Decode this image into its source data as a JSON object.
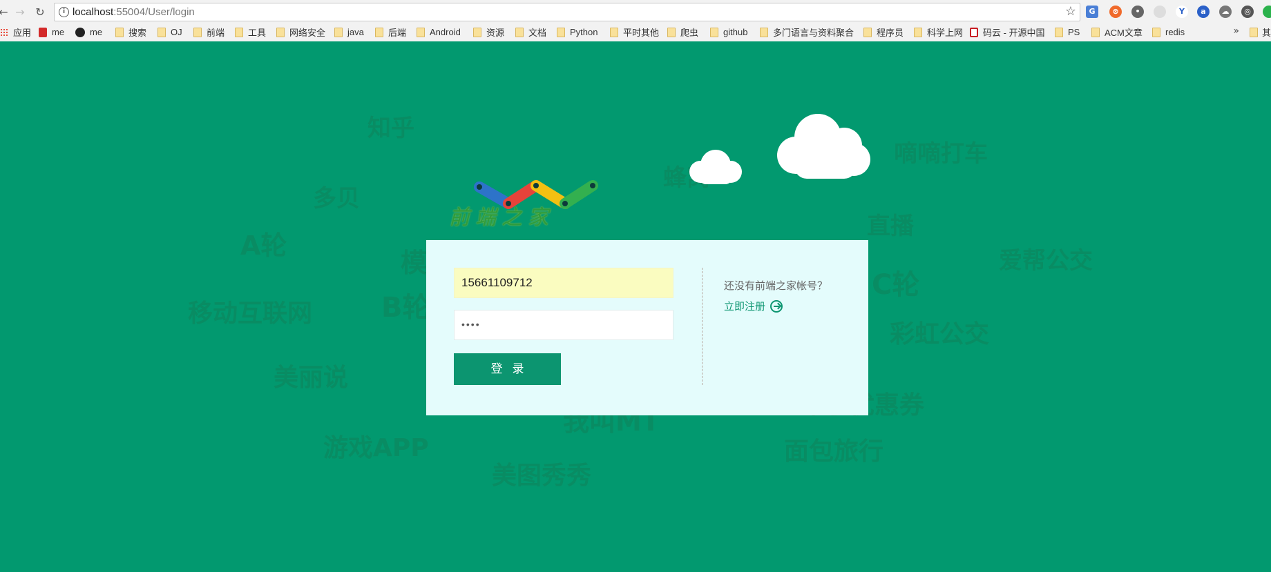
{
  "browser": {
    "url_host": "localhost",
    "url_rest": ":55004/User/login",
    "bookmarks": [
      {
        "label": "应用",
        "icon": "apps-icon"
      },
      {
        "label": "me",
        "icon": "red-square-icon"
      },
      {
        "label": "me",
        "icon": "github-icon"
      },
      {
        "label": "搜索",
        "icon": "folder-icon"
      },
      {
        "label": "OJ",
        "icon": "folder-icon"
      },
      {
        "label": "前端",
        "icon": "folder-icon"
      },
      {
        "label": "工具",
        "icon": "folder-icon"
      },
      {
        "label": "网络安全",
        "icon": "folder-icon"
      },
      {
        "label": "java",
        "icon": "folder-icon"
      },
      {
        "label": "后端",
        "icon": "folder-icon"
      },
      {
        "label": "Android",
        "icon": "folder-icon"
      },
      {
        "label": "资源",
        "icon": "folder-icon"
      },
      {
        "label": "文档",
        "icon": "folder-icon"
      },
      {
        "label": "Python",
        "icon": "folder-icon"
      },
      {
        "label": "平时其他",
        "icon": "folder-icon"
      },
      {
        "label": "爬虫",
        "icon": "folder-icon"
      },
      {
        "label": "github",
        "icon": "folder-icon"
      },
      {
        "label": "多门语言与资料聚合",
        "icon": "folder-icon"
      },
      {
        "label": "程序员",
        "icon": "folder-icon"
      },
      {
        "label": "科学上网",
        "icon": "folder-icon"
      },
      {
        "label": "码云 - 开源中国",
        "icon": "gitee-icon"
      },
      {
        "label": "PS",
        "icon": "folder-icon"
      },
      {
        "label": "ACM文章",
        "icon": "folder-icon"
      },
      {
        "label": "redis",
        "icon": "folder-icon"
      }
    ],
    "more": "»",
    "other_bookmarks": "其"
  },
  "background_words": [
    "知乎",
    "嘀嘀打车",
    "多贝",
    "蜂窝",
    "A轮",
    "直播",
    "爱帮公交",
    "移动互联网",
    "B轮",
    "C轮",
    "彩虹公交",
    "美丽说",
    "布丁优惠券",
    "我叫MT",
    "游戏APP",
    "面包旅行",
    "美图秀秀",
    "模"
  ],
  "logo": {
    "text": "前端之家"
  },
  "login": {
    "username_value": "15661109712",
    "password_value": "••••",
    "submit_label": "登录",
    "no_account_text": "还没有前端之家帐号？",
    "register_link": "立即注册"
  },
  "colors": {
    "background": "#02996f",
    "card": "#e4fcfc",
    "button": "#0c9570",
    "username_autofill": "#fafcc0"
  }
}
